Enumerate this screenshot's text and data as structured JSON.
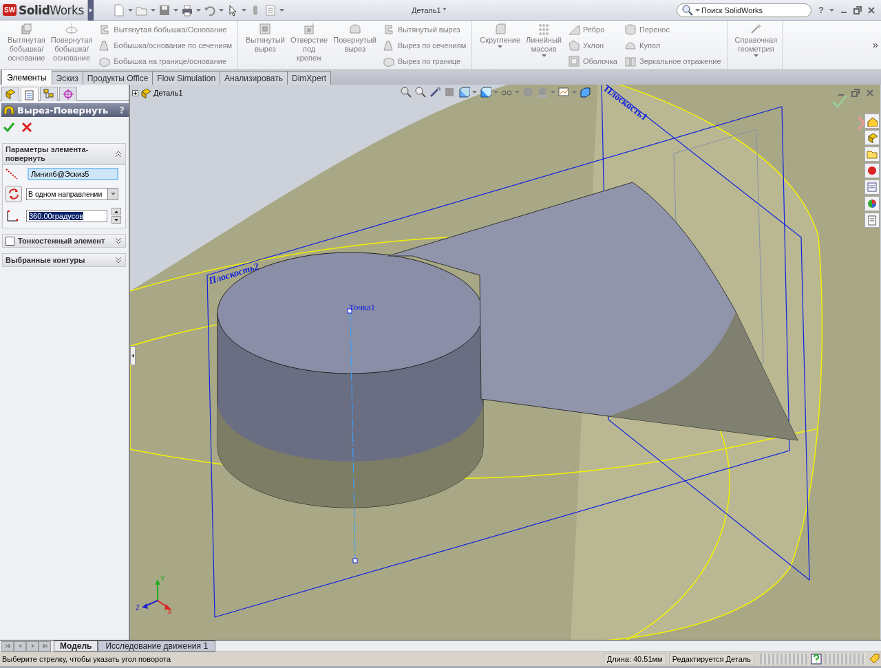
{
  "app": {
    "logo_mark": "SW",
    "name_bold": "Solid",
    "name_rest": "Works"
  },
  "window": {
    "title": "Деталь1 *"
  },
  "search": {
    "placeholder": "Поиск SolidWorks"
  },
  "help": "?",
  "ribbon": {
    "more": "»",
    "groups": [
      {
        "items": [
          {
            "kind": "large",
            "label": "Вытянутая бобышка/основание",
            "disabled": true
          },
          {
            "kind": "large",
            "label": "Повернутая бобышка/основание",
            "disabled": true
          },
          {
            "kind": "stack",
            "items": [
              {
                "label": "Вытянутая бобышка/Основание",
                "disabled": true
              },
              {
                "label": "Бобышка/основание по сечениям",
                "disabled": true
              },
              {
                "label": "Бобышка на границе/основание",
                "disabled": true
              }
            ]
          }
        ]
      },
      {
        "items": [
          {
            "kind": "large",
            "label": "Вытянутый вырез",
            "disabled": true
          },
          {
            "kind": "large",
            "label": "Отверстие под крепеж",
            "disabled": true
          },
          {
            "kind": "large",
            "label": "Повернутый вырез",
            "disabled": true
          },
          {
            "kind": "stack",
            "items": [
              {
                "label": "Вытянутый вырез",
                "disabled": true
              },
              {
                "label": "Вырез по сечениям",
                "disabled": true
              },
              {
                "label": "Вырез по границе",
                "disabled": true
              }
            ]
          }
        ]
      },
      {
        "items": [
          {
            "kind": "large",
            "label": "Скругление",
            "disabled": true,
            "dropdown": true
          },
          {
            "kind": "large",
            "label": "Линейный массив",
            "disabled": true,
            "dropdown": true
          },
          {
            "kind": "stack",
            "items": [
              {
                "label": "Ребро",
                "disabled": true
              },
              {
                "label": "Уклон",
                "disabled": true
              },
              {
                "label": "Оболочка",
                "disabled": true
              }
            ]
          },
          {
            "kind": "stack",
            "items": [
              {
                "label": "Перенос",
                "disabled": true
              },
              {
                "label": "Купол",
                "disabled": true
              },
              {
                "label": "Зеркальное отражение",
                "disabled": true
              }
            ]
          }
        ]
      },
      {
        "items": [
          {
            "kind": "large",
            "label": "Справочная геометрия",
            "disabled": true,
            "dropdown": true
          }
        ]
      }
    ]
  },
  "tabs": [
    {
      "label": "Элементы",
      "selected": true
    },
    {
      "label": "Эскиз",
      "selected": false
    },
    {
      "label": "Продукты Office",
      "selected": false
    },
    {
      "label": "Flow Simulation",
      "selected": false
    },
    {
      "label": "Анализировать",
      "selected": false
    },
    {
      "label": "DimXpert",
      "selected": false
    }
  ],
  "manager_tabs": [
    {
      "kind": "tree",
      "selected": false
    },
    {
      "kind": "property",
      "selected": true
    },
    {
      "kind": "configuration",
      "selected": false
    },
    {
      "kind": "dimxpert",
      "selected": false
    }
  ],
  "feature": {
    "title": "Вырез-Повернуть",
    "help": "?"
  },
  "sections": [
    {
      "kind": "plain",
      "title": "Параметры элемента-повернуть",
      "expanded": true,
      "fields": [
        {
          "kind": "selection",
          "value": "Линия6@Эскиз5"
        },
        {
          "kind": "dropdown",
          "value": "В одном направлении"
        },
        {
          "kind": "spinner",
          "value": "360.00градусов",
          "text_selected": true
        }
      ]
    },
    {
      "kind": "checkbox",
      "title": "Тонкостенный элемент",
      "checked": false,
      "expanded": false
    },
    {
      "kind": "plain",
      "title": "Выбранные контуры",
      "expanded": false
    }
  ],
  "viewport": {
    "tree_root": "Деталь1",
    "tree_expanded": false,
    "plane_labels": [
      "Плоскость2",
      "Плоскость1"
    ],
    "point_label": "Точка1",
    "triad": {
      "y": "Y",
      "z": "Z",
      "x": "X"
    }
  },
  "bottom_tabs": [
    {
      "label": "Модель",
      "selected": true
    },
    {
      "label": "Исследование движения 1",
      "selected": false
    }
  ],
  "status": {
    "message": "Выберите стрелку, чтобы указать угол поворота",
    "length": "Длина: 40.51мм",
    "mode": "Редактируется Деталь"
  }
}
